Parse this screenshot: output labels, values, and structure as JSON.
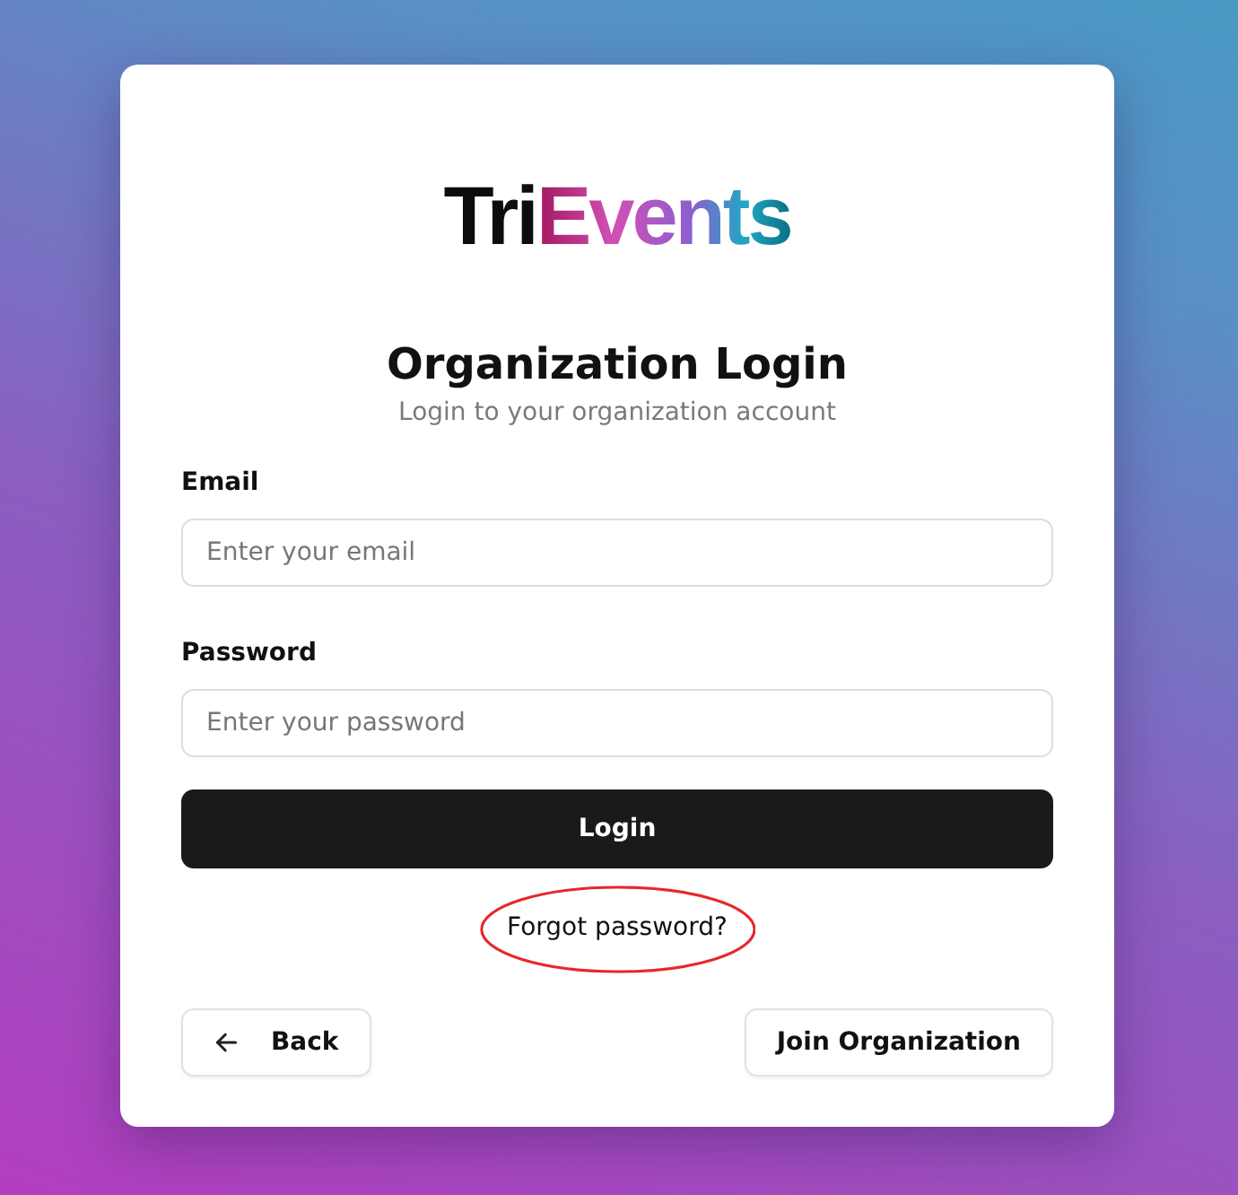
{
  "logo": {
    "plain": "Tri",
    "accent": "Events"
  },
  "title": "Organization Login",
  "subtitle": "Login to your organization account",
  "fields": [
    {
      "label": "Email",
      "placeholder": "Enter your email"
    },
    {
      "label": "Password",
      "placeholder": "Enter your password"
    }
  ],
  "login_button": "Login",
  "forgot_link": {
    "label": "Forgot password?",
    "highlighted": true
  },
  "back_button": {
    "label": "Back"
  },
  "join_button": "Join Organization"
}
